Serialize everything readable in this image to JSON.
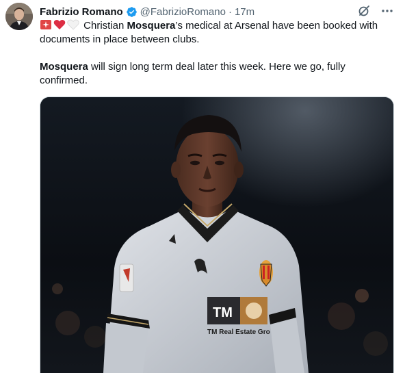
{
  "author": {
    "name": "Fabrizio Romano",
    "handle": "@FabrizioRomano",
    "separator": "·",
    "time": "17m",
    "avatar_icon": "profile-avatar",
    "verified_icon": "verified-badge-icon"
  },
  "actions": {
    "grok_icon": "grok-icon",
    "more_icon": "more-options-icon"
  },
  "tweet": {
    "emoji": [
      "alarm-light",
      "red-heart",
      "white-heart"
    ],
    "line1_pre": " Christian ",
    "line1_bold": "Mosquera",
    "line1_post": "’s medical at Arsenal have been booked with documents in place between clubs.",
    "line2_bold": "Mosquera",
    "line2_post": " will sign long term deal later this week. Here we go, fully confirmed."
  },
  "media": {
    "description_icon": "football-player-photo",
    "sponsor_logo": "TM",
    "sponsor_text": "TM Real Estate Gro",
    "colors": {
      "kit": "#c9cdd4",
      "kit_trim": "#151515",
      "background": "#0c1016"
    }
  },
  "colors": {
    "verified": "#1d9bf0",
    "secondary_text": "#536471"
  }
}
